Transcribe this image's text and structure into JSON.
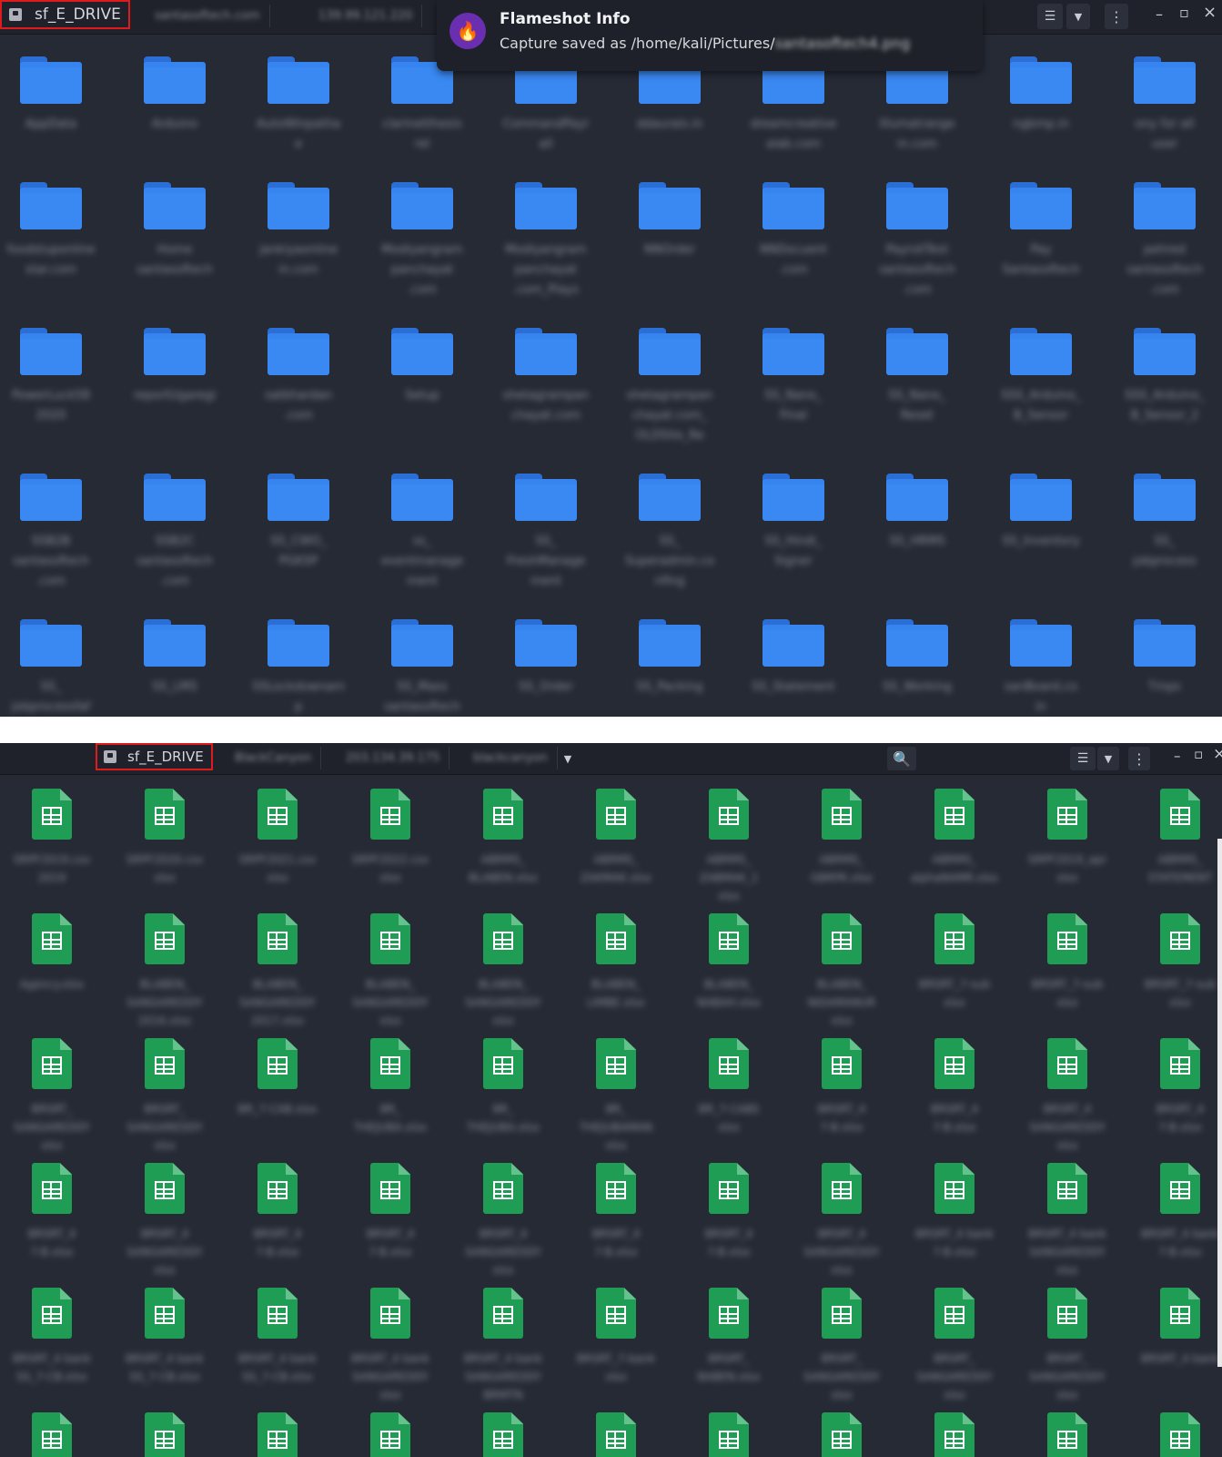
{
  "top_window": {
    "active_tab": "sf_E_DRIVE",
    "breadcrumbs": [
      "santasoftech.com",
      "139.99.121.220"
    ],
    "folders": [
      [
        "AppData",
        "Arduino",
        "AutoWinpatha\ne",
        "clarinetthesis\nrel",
        "CommandPayr\nall",
        "ddaurais.in",
        "dreamcreative\nalab.com",
        "Illumatrange\nin.com",
        "ngbmp.in",
        "ony for all\nuser"
      ],
      [
        "foodstuponline\nstar.com",
        "Home\nsantasoftech",
        "jankiyaonline\nin.com",
        "Modiyangram\npanchayat\n.com",
        "Modiyangram\npanchayat\n.com_Plays",
        "NNOrder",
        "NNDocuent\n.com",
        "PayrollTest\nsantasoftech\n.com",
        "Pay\nSantasoftech",
        "pehred\nsantasoftech\n.com"
      ],
      [
        "PowerLuck58\n2020",
        "reportUgaregi",
        "satbhardan\n.com",
        "Setup",
        "shetagrampan\nchayat.com",
        "shetagrampan\nchayat.com_\nOLDSite_Re",
        "SS_Nano_\nFinal",
        "SS_Nano_\nReset",
        "SSS_Arduino_\nB_Sensor",
        "SSS_Arduino_\nB_Sensor_2"
      ],
      [
        "SSB2B\nsantasoftech\n.com",
        "SSB2C\nsantasoftech\n.com",
        "SS_CWO_\nPGKSP",
        "ss_\neventmanage\nment",
        "SS_\nFreshManage\nment",
        "SS_\nSuperadmin.co\nnfing",
        "SS_Hindi_\nSigner",
        "SS_HRMS",
        "SS_Inventory",
        "SS_\njobprocess"
      ],
      [
        "SS_\njobprocessfaf",
        "SS_LMS",
        "SSLockdownam\np",
        "SS_Mass\nsantasoftech",
        "SS_Order",
        "SS_Packing",
        "SS_Statement",
        "SS_Working",
        "sanBoard.co\nin",
        "Tmps"
      ]
    ],
    "controls": {
      "view_icon": "list-view-icon",
      "more_icon": "kebab-menu-icon",
      "minimize": "–",
      "maximize": "▫",
      "close": "×"
    }
  },
  "notification": {
    "title": "Flameshot Info",
    "message_prefix": "Capture saved as /home/kali/Pictures/",
    "message_redacted": "santasoftech4.png"
  },
  "bottom_window": {
    "active_tab": "sf_E_DRIVE",
    "breadcrumbs": [
      "BlackCanyon",
      "203.134.39.175",
      "blackcanyon"
    ],
    "rows": 6,
    "cols": 11,
    "file_labels": [
      [
        "SRPF2019.csv\n2019",
        "SRPF2020.csv\nxlsx",
        "SRPF2021.csv\nxlsx",
        "SRPF2022.csv\nxlsx",
        "ABRMS_\nBLABEN.xlsx",
        "ABRMS_\nZAKMAK.xlsx",
        "ABRMS_\nZABMAK_1\nxlsx",
        "ABRMS_\nGBRPK.xlsx",
        "ABRMS_\nalphaNAMR.xlsx",
        "SRPF2019_apr\nxlsx",
        "ABRMS_\nSTATEMENT"
      ],
      [
        "Agency.xlsx",
        "BLABEN_\nSANGAREDDY\n2016.xlsx",
        "BLABEN_\nSANGAREDDY\n2017.xlsx",
        "BLABEN_\nSANGAREDDY\nxlsx",
        "BLABEN_\nSANGAREDDY\nxlsx",
        "BLABEN_\nLIMBE.xlsx",
        "BLABEN_\nNABAH.xlsx",
        "BLABEN_\nNIDAMANUR\nxlsx",
        "BRSRT_7-sub\nxlsx",
        "BRSRT_7-sub\nxlsx",
        "BRSRT_7-sub\nxlsx"
      ],
      [
        "BRSRT_\nSANGAREDDY\nxlsx",
        "BRSRT_\nSANGAREDDY\nxlsx",
        "BR_7-CAB.xlsx",
        "BR_\nTHEJUBA.xlsx",
        "BR_\nTHEJUBA.xlsx",
        "BR_\nTHEJUBAMAN\nxlsx",
        "BR_7-CABS\nxlsx",
        "BRSRT_4\n7-B.xlsx",
        "BRSRT_4\n7-B.xlsx",
        "BRSRT_4\nSANGAREDDY\nxlsx",
        "BRSRT_4\n7-B.xlsx"
      ],
      [
        "BRSRT_4\n7-B.xlsx",
        "BRSRT_4\nSANGAREDDY\nxlsx",
        "BRSRT_4\n7-B.xlsx",
        "BRSRT_4\n7-B.xlsx",
        "BRSRT_4\nSANGAREDDY\nxlsx",
        "BRSRT_4\n7-B.xlsx",
        "BRSRT_4\n7-B.xlsx",
        "BRSRT_4\nSANGAREDDY\nxlsx",
        "BRSRT_4 bank\n7-B.xlsx",
        "BRSRT_4 bank\nSANGAREDDY\nxlsx",
        "BRSRT_4 bank\n7-B.xlsx"
      ],
      [
        "BRSRT_4 bank\nSS_7-CB.xlsx",
        "BRSRT_4 bank\nSS_7-CB.xlsx",
        "BRSRT_4 bank\nSS_7-CB.xlsx",
        "BRSRT_4 bank\nSANGAREDDY\nxlsx",
        "BRSRT_4 bank\nSANGAREDDY\nBRMTN",
        "BRSRT_7-bank\nxlsx",
        "BRSRT_\nBABEN.xlsx",
        "BRSRT_\nSANGAREDDY\nxlsx",
        "BRSRT_\nSANGAREDDY\nxlsx",
        "BRSRT_\nSANGAREDDY\nxlsx",
        "BRSRT_4 bank"
      ],
      [
        "",
        "",
        "",
        "",
        "",
        "",
        "",
        "",
        "",
        "",
        ""
      ]
    ],
    "controls": {
      "search_icon": "search-icon",
      "view_icon": "list-view-icon",
      "more_icon": "kebab-menu-icon",
      "minimize": "–",
      "maximize": "▫",
      "close": "×"
    }
  }
}
